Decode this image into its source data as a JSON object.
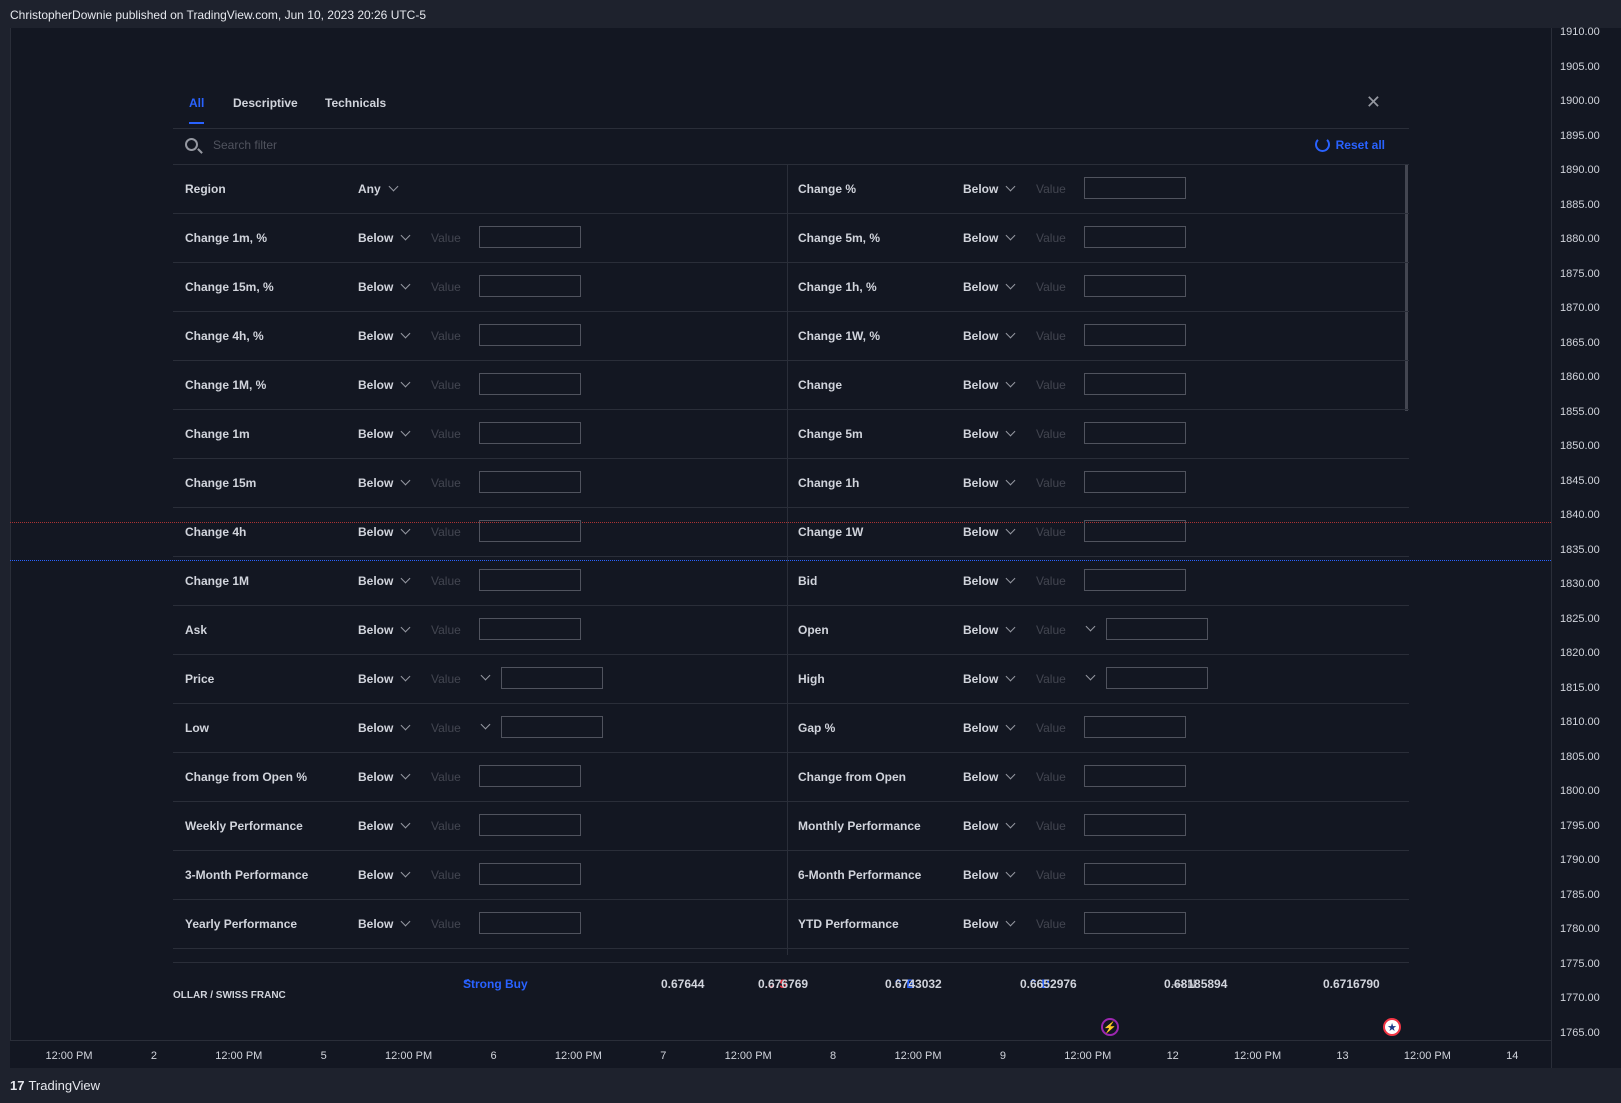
{
  "header": {
    "attribution": "ChristopherDownie published on TradingView.com, Jun 10, 2023 20:26 UTC-5"
  },
  "price_axis": [
    "1910.00",
    "1905.00",
    "1900.00",
    "1895.00",
    "1890.00",
    "1885.00",
    "1880.00",
    "1875.00",
    "1870.00",
    "1865.00",
    "1860.00",
    "1855.00",
    "1850.00",
    "1845.00",
    "1840.00",
    "1835.00",
    "1830.00",
    "1825.00",
    "1820.00",
    "1815.00",
    "1810.00",
    "1805.00",
    "1800.00",
    "1795.00",
    "1790.00",
    "1785.00",
    "1780.00",
    "1775.00",
    "1770.00",
    "1765.00"
  ],
  "time_axis": [
    "12:00 PM",
    "2",
    "12:00 PM",
    "5",
    "12:00 PM",
    "6",
    "12:00 PM",
    "7",
    "12:00 PM",
    "8",
    "12:00 PM",
    "9",
    "12:00 PM",
    "12",
    "12:00 PM",
    "13",
    "12:00 PM",
    "14"
  ],
  "footer": {
    "brand": "TradingView",
    "logo_mark": "17"
  },
  "filter_panel": {
    "tabs": [
      {
        "label": "All",
        "active": true
      },
      {
        "label": "Descriptive",
        "active": false
      },
      {
        "label": "Technicals",
        "active": false
      }
    ],
    "search_placeholder": "Search filter",
    "reset_label": "Reset all",
    "close_icon": "close-icon",
    "region": {
      "label": "Region",
      "value": "Any"
    },
    "condition": "Below",
    "value_placeholder": "Value",
    "rows": [
      [
        {
          "label": "Region",
          "type": "select"
        },
        {
          "label": "Change %"
        }
      ],
      [
        {
          "label": "Change 1m, %"
        },
        {
          "label": "Change 5m, %"
        }
      ],
      [
        {
          "label": "Change 15m, %"
        },
        {
          "label": "Change 1h, %"
        }
      ],
      [
        {
          "label": "Change 4h, %"
        },
        {
          "label": "Change 1W, %"
        }
      ],
      [
        {
          "label": "Change 1M, %"
        },
        {
          "label": "Change"
        }
      ],
      [
        {
          "label": "Change 1m"
        },
        {
          "label": "Change 5m"
        }
      ],
      [
        {
          "label": "Change 15m"
        },
        {
          "label": "Change 1h"
        }
      ],
      [
        {
          "label": "Change 4h"
        },
        {
          "label": "Change 1W"
        }
      ],
      [
        {
          "label": "Change 1M"
        },
        {
          "label": "Bid"
        }
      ],
      [
        {
          "label": "Ask"
        },
        {
          "label": "Open",
          "dropdown": true
        }
      ],
      [
        {
          "label": "Price",
          "dropdown": true
        },
        {
          "label": "High",
          "dropdown": true
        }
      ],
      [
        {
          "label": "Low",
          "dropdown": true
        },
        {
          "label": "Gap %"
        }
      ],
      [
        {
          "label": "Change from Open %"
        },
        {
          "label": "Change from Open"
        }
      ],
      [
        {
          "label": "Weekly Performance"
        },
        {
          "label": "Monthly Performance"
        }
      ],
      [
        {
          "label": "3-Month Performance"
        },
        {
          "label": "6-Month Performance"
        }
      ],
      [
        {
          "label": "Yearly Performance"
        },
        {
          "label": "YTD Performance"
        }
      ]
    ]
  },
  "ticker_row": {
    "symbol": "OLLAR / SWISS FRANC",
    "rating": "Strong Buy",
    "rating_glyph": "⌃",
    "values": [
      {
        "text": "0.67644",
        "signal": "",
        "signal_color": ""
      },
      {
        "text": "0.676769",
        "signal": "⌄ S",
        "signal_color": "red"
      },
      {
        "text": "0.6743032",
        "signal": "⌃ B",
        "signal_color": "blue"
      },
      {
        "text": "0.6652976",
        "signal": "⌃ B",
        "signal_color": "blue"
      },
      {
        "text": "0.68185894",
        "signal": "— N",
        "signal_color": "grey"
      },
      {
        "text": "0.6716790",
        "signal": "",
        "signal_color": ""
      }
    ]
  },
  "colors": {
    "accent": "#2962ff",
    "sell": "#f23645",
    "background": "#131722"
  }
}
